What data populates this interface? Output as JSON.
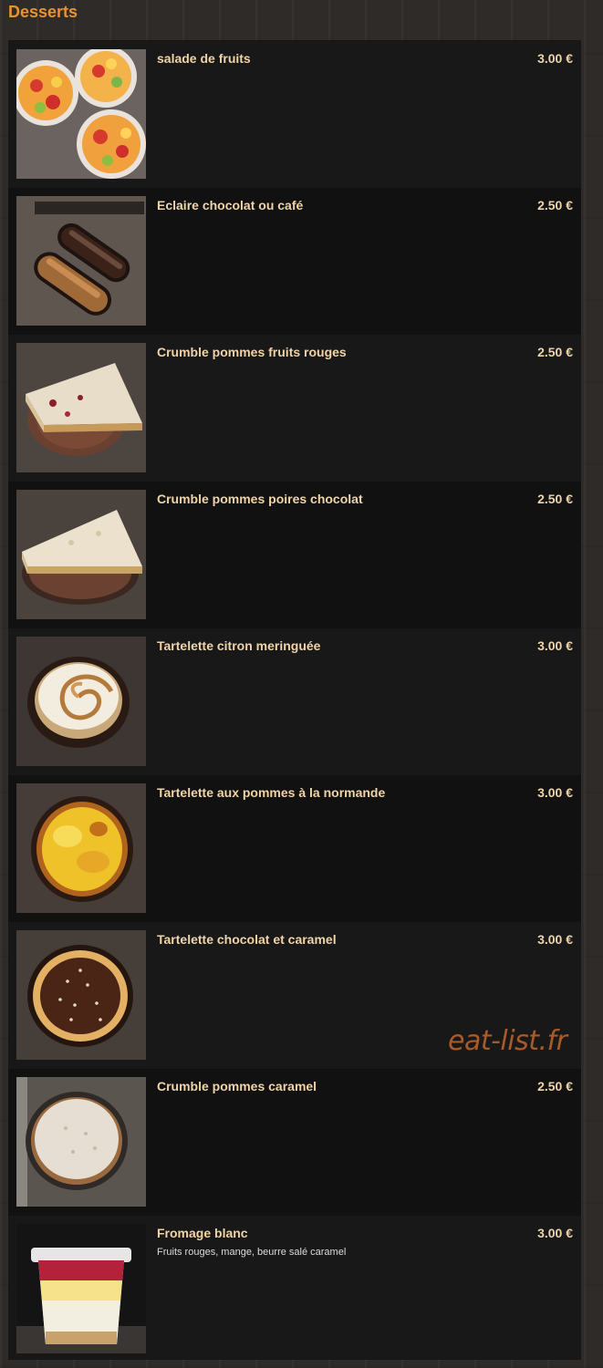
{
  "section": {
    "title": "Desserts"
  },
  "items": [
    {
      "name": "salade de fruits",
      "price": "3.00 €",
      "desc": "",
      "image": "fruit-salad-image"
    },
    {
      "name": "Eclaire chocolat ou café",
      "price": "2.50 €",
      "desc": "",
      "image": "eclair-image"
    },
    {
      "name": "Crumble pommes fruits rouges",
      "price": "2.50 €",
      "desc": "",
      "image": "crumble-red-fruits-image"
    },
    {
      "name": "Crumble pommes poires chocolat",
      "price": "2.50 €",
      "desc": "",
      "image": "crumble-pear-chocolate-image"
    },
    {
      "name": "Tartelette citron meringuée",
      "price": "3.00 €",
      "desc": "",
      "image": "lemon-meringue-tart-image"
    },
    {
      "name": "Tartelette aux pommes à la normande",
      "price": "3.00 €",
      "desc": "",
      "image": "apple-tart-image"
    },
    {
      "name": "Tartelette chocolat et caramel",
      "price": "3.00 €",
      "desc": "",
      "image": "chocolate-caramel-tart-image"
    },
    {
      "name": "Crumble pommes caramel",
      "price": "2.50 €",
      "desc": "",
      "image": "crumble-caramel-image"
    },
    {
      "name": "Fromage blanc",
      "price": "3.00 €",
      "desc": "Fruits rouges, mange, beurre salé caramel",
      "image": "fromage-blanc-cup-image"
    }
  ],
  "watermark": "eat-list.fr",
  "colors": {
    "accent": "#e8932c",
    "item_text": "#f0d4a8",
    "watermark": "#b8622a"
  }
}
